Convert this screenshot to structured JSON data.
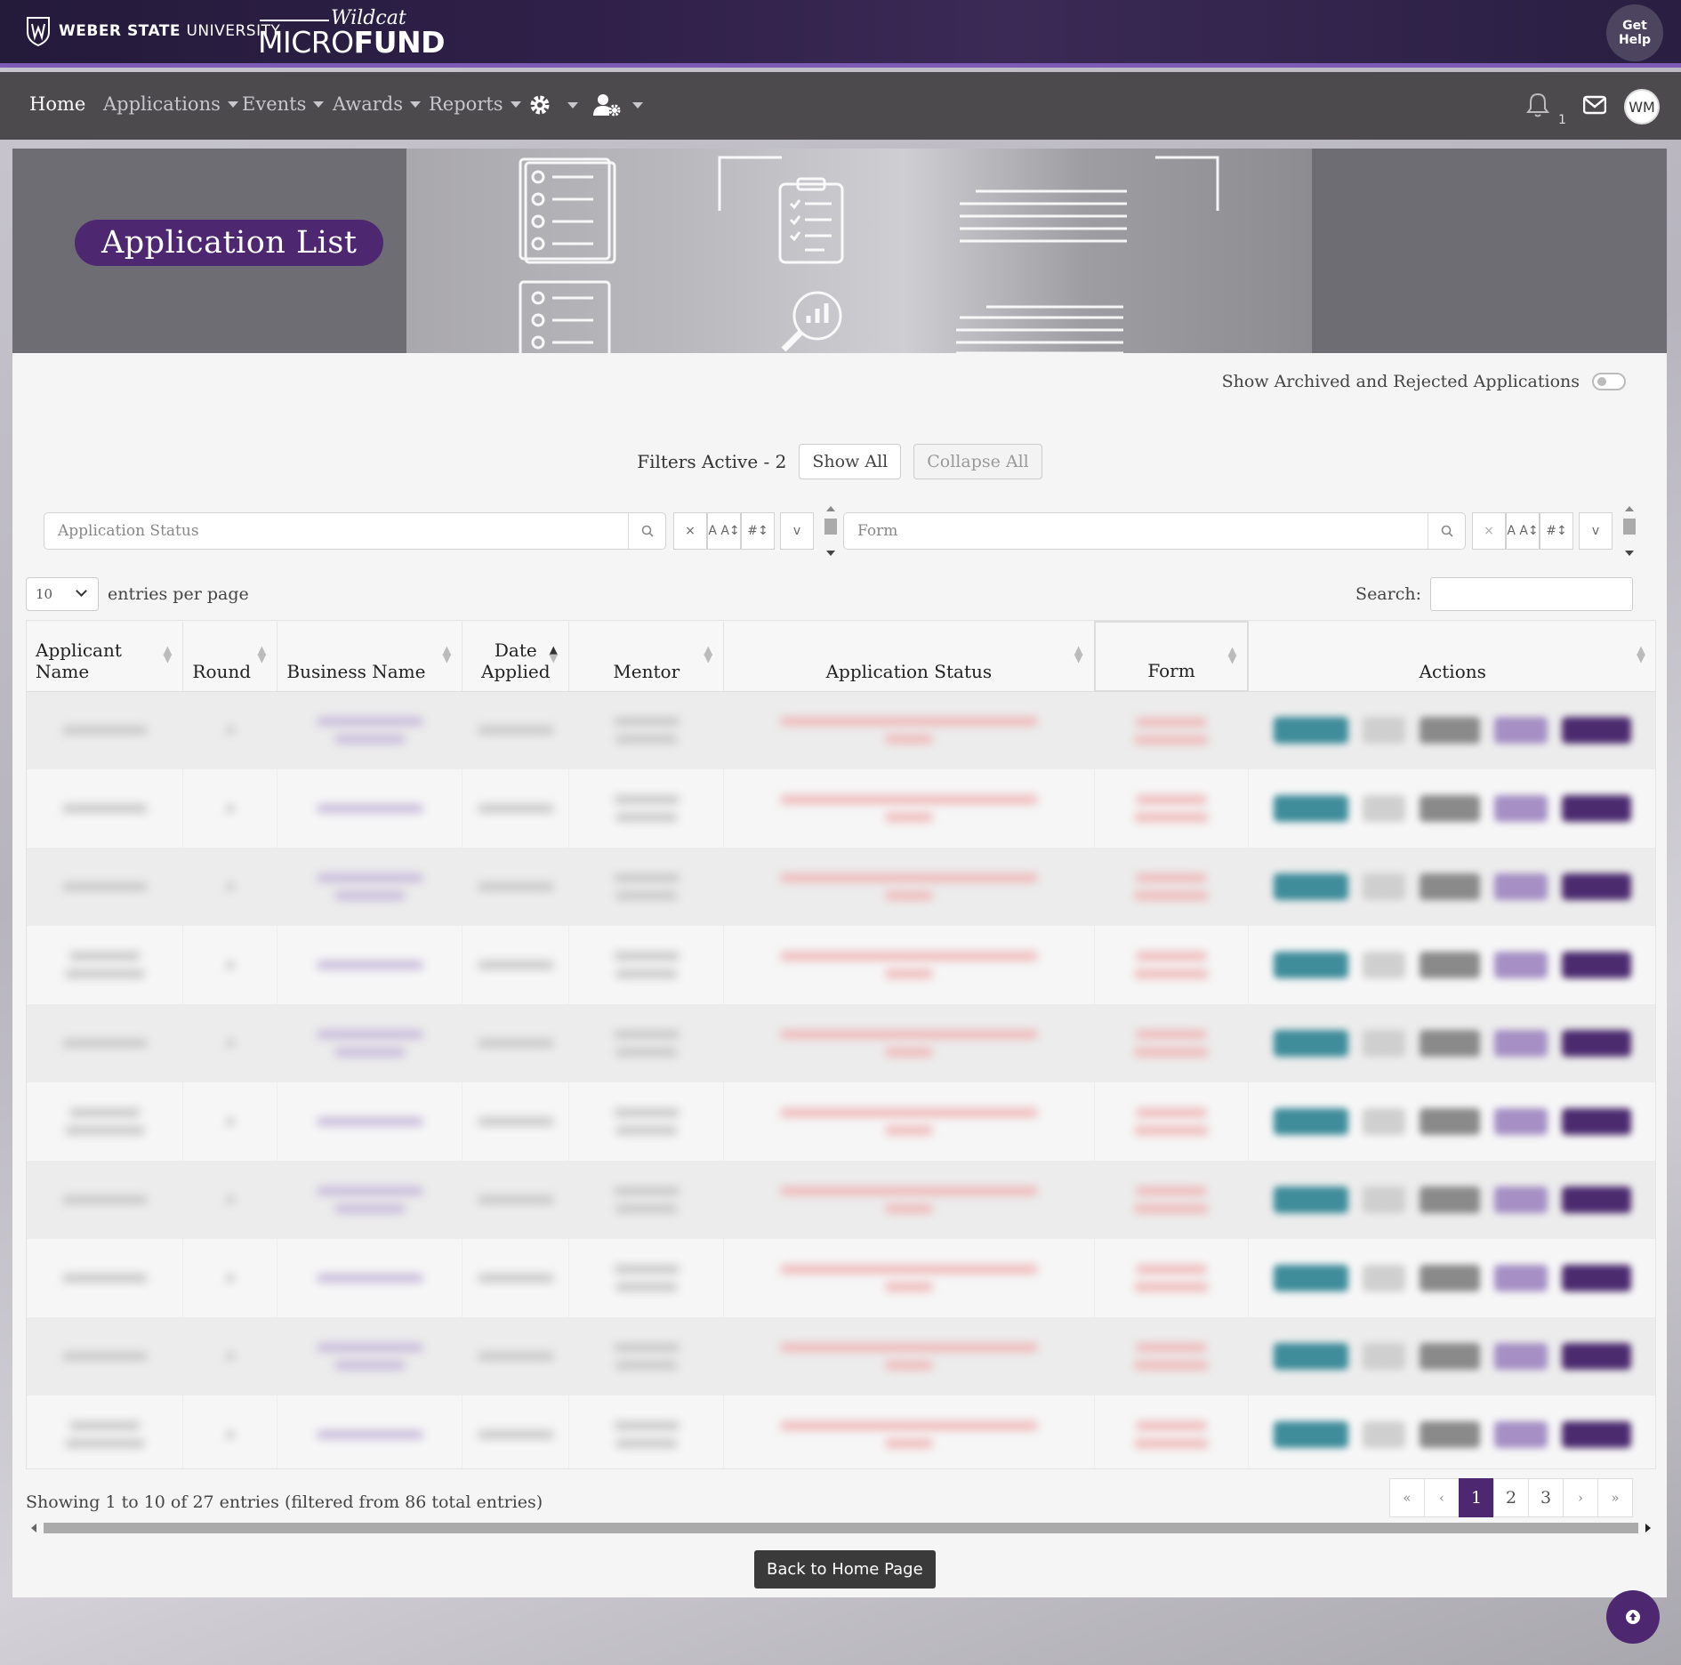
{
  "brand": {
    "university": "WEBER STATE",
    "university_suffix": "UNIVERSITY",
    "app_script": "Wildcat",
    "app_name_light": "MICRO",
    "app_name_bold": "FUND",
    "help_line1": "Get",
    "help_line2": "Help"
  },
  "nav": {
    "home": "Home",
    "applications": "Applications",
    "events": "Events",
    "awards": "Awards",
    "reports": "Reports",
    "notification_count": "1",
    "avatar_initials": "WM"
  },
  "banner": {
    "title": "Application List"
  },
  "archived_toggle_label": "Show Archived and Rejected Applications",
  "filters": {
    "active_label": "Filters Active - 2",
    "show_all": "Show All",
    "collapse_all": "Collapse All",
    "filter1_placeholder": "Application Status",
    "filter2_placeholder": "Form",
    "clear_symbol": "×",
    "alpha_sort_symbol": "A A↕",
    "num_sort_symbol": "#↕",
    "expand_symbol": "v"
  },
  "length": {
    "value": "10",
    "label": "entries per page"
  },
  "search": {
    "label": "Search:"
  },
  "table": {
    "columns": [
      {
        "line1": "Applicant",
        "line2": "Name"
      },
      {
        "line1": "",
        "line2": "Round"
      },
      {
        "line1": "",
        "line2": "Business Name"
      },
      {
        "line1": "Date",
        "line2": "Applied"
      },
      {
        "line1": "",
        "line2": "Mentor"
      },
      {
        "line1": "",
        "line2": "Application Status"
      },
      {
        "line1": "",
        "line2": "Form"
      },
      {
        "line1": "",
        "line2": "Actions"
      }
    ],
    "row_count": 10
  },
  "footer": {
    "showing": "Showing 1 to 10 of 27 entries (filtered from 86 total entries)",
    "pages": [
      "«",
      "‹",
      "1",
      "2",
      "3",
      "›",
      "»"
    ],
    "active_page": "1",
    "back_button": "Back to Home Page"
  },
  "colors": {
    "brand_purple": "#4d2870",
    "accent_purple": "#7d5ab5",
    "nav_bg": "#4c4a4d"
  },
  "icons": [
    "shield-icon",
    "settings-icon",
    "user-settings-icon",
    "bell-icon",
    "envelope-icon",
    "search-icon",
    "arrow-up-icon"
  ]
}
